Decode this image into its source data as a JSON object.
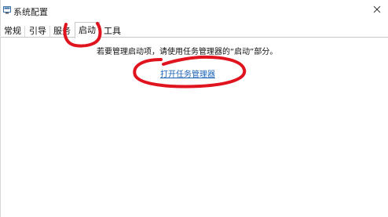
{
  "window": {
    "title": "系统配置",
    "icon": "system-config-icon",
    "close_icon": "close-icon"
  },
  "tabs": [
    {
      "label": "常规",
      "selected": false
    },
    {
      "label": "引导",
      "selected": false
    },
    {
      "label": "服务",
      "selected": false
    },
    {
      "label": "启动",
      "selected": true
    },
    {
      "label": "工具",
      "selected": false
    }
  ],
  "startup": {
    "message": "若要管理启动项，请使用任务管理器的“启动”部分。",
    "link_label": "打开任务管理器"
  },
  "colors": {
    "link": "#1a62b8",
    "annotation": "#e0141e"
  }
}
